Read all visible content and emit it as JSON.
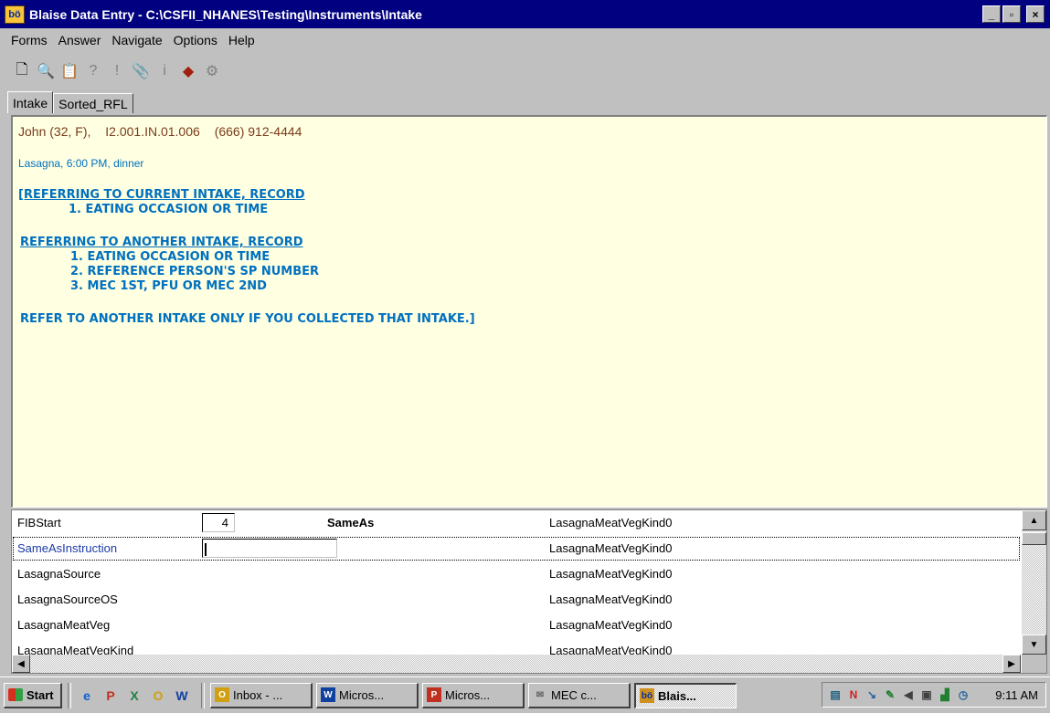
{
  "window": {
    "title": "Blaise Data Entry - C:\\CSFII_NHANES\\Testing\\Instruments\\Intake",
    "app_icon_text": "bö",
    "controls": [
      "_",
      "▫",
      "×"
    ]
  },
  "menu": [
    {
      "label": "Forms"
    },
    {
      "label": "Answer"
    },
    {
      "label": "Navigate"
    },
    {
      "label": "Options"
    },
    {
      "label": "Help"
    }
  ],
  "toolbar": [
    {
      "icon": "new-form-icon",
      "glyph": "🗋"
    },
    {
      "icon": "find-form-icon",
      "glyph": "🔍"
    },
    {
      "icon": "browse-forms-icon",
      "glyph": "📋"
    },
    {
      "icon": "dont-know-icon",
      "glyph": "?"
    },
    {
      "icon": "refusal-icon",
      "glyph": "!"
    },
    {
      "icon": "remark-icon",
      "glyph": "📎"
    },
    {
      "icon": "info-icon",
      "glyph": "i"
    },
    {
      "icon": "watch-icon",
      "glyph": "◆"
    },
    {
      "icon": "parallel-block-icon",
      "glyph": "⚙"
    }
  ],
  "tabs": [
    {
      "label": "Intake",
      "active": true
    },
    {
      "label": "Sorted_RFL",
      "active": false
    }
  ],
  "question": {
    "respondent": "John (32, F),",
    "id": "I2.001.IN.01.006",
    "phone": "(666) 912-4444",
    "food_line": "Lasagna, 6:00 PM, dinner",
    "heading1": "[REFERRING TO CURRENT INTAKE, RECORD",
    "item1_1": "1. EATING OCCASION OR TIME",
    "heading2": "REFERRING TO ANOTHER INTAKE, RECORD",
    "item2_1": "1. EATING OCCASION OR TIME",
    "item2_2": "2. REFERENCE PERSON'S SP NUMBER",
    "item2_3": "3. MEC 1ST, PFU OR MEC 2ND",
    "note": "REFER TO ANOTHER INTAKE ONLY IF YOU COLLECTED THAT INTAKE.]"
  },
  "grid": {
    "rows": [
      {
        "field": "FIBStart",
        "answer": "4",
        "label": "SameAs",
        "scope": "LasagnaMeatVegKind0"
      },
      {
        "field": "SameAsInstruction",
        "answer": "",
        "label": "",
        "scope": "LasagnaMeatVegKind0",
        "current": true
      },
      {
        "field": "LasagnaSource",
        "answer": "",
        "label": "",
        "scope": "LasagnaMeatVegKind0"
      },
      {
        "field": "LasagnaSourceOS",
        "answer": "",
        "label": "",
        "scope": "LasagnaMeatVegKind0"
      },
      {
        "field": "LasagnaMeatVeg",
        "answer": "",
        "label": "",
        "scope": "LasagnaMeatVegKind0"
      },
      {
        "field": "LasagnaMeatVegKind",
        "answer": "",
        "label": "",
        "scope": "LasagnaMeatVegKind0"
      }
    ]
  },
  "taskbar": {
    "start_label": "Start",
    "quick_launch": [
      {
        "icon": "internet-explorer-icon",
        "glyph": "e",
        "color": "#1060d0"
      },
      {
        "icon": "powerpoint-icon",
        "glyph": "P",
        "color": "#c03020"
      },
      {
        "icon": "excel-icon",
        "glyph": "X",
        "color": "#208040"
      },
      {
        "icon": "outlook-icon",
        "glyph": "O",
        "color": "#d0a010"
      },
      {
        "icon": "word-icon",
        "glyph": "W",
        "color": "#1040a0"
      }
    ],
    "tasks": [
      {
        "label": "Inbox - ...",
        "icon": "outlook-icon",
        "glyph": "O",
        "color": "#d0a010"
      },
      {
        "label": "Micros...",
        "icon": "word-icon",
        "glyph": "W",
        "color": "#1040a0"
      },
      {
        "label": "Micros...",
        "icon": "powerpoint-icon",
        "glyph": "P",
        "color": "#c03020"
      },
      {
        "label": "MEC c...",
        "icon": "mail-icon",
        "glyph": "✉",
        "color": "#606060"
      },
      {
        "label": "Blais...",
        "icon": "blaise-icon",
        "glyph": "bö",
        "color": "#d09020",
        "active": true
      }
    ],
    "tray_icons": [
      "network-icon",
      "norton-icon",
      "speaker-icon",
      "pen-icon",
      "volume-icon",
      "printer-icon",
      "monitor-icon",
      "clock-icon"
    ],
    "clock": "9:11 AM"
  }
}
